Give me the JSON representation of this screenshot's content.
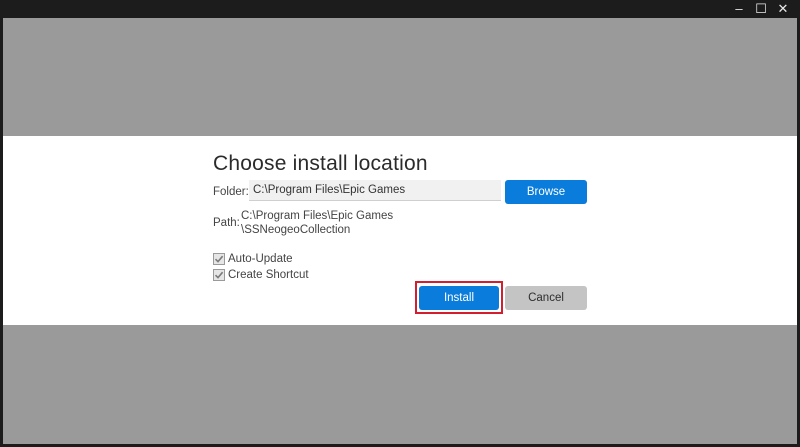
{
  "window": {
    "controls": {
      "minimize": "–",
      "maximize": "☐",
      "close": "✕"
    }
  },
  "dialog": {
    "title": "Choose install location",
    "folder": {
      "label": "Folder:",
      "value": "C:\\Program Files\\Epic Games"
    },
    "browse_label": "Browse",
    "path": {
      "label": "Path:",
      "line1": "C:\\Program Files\\Epic Games",
      "line2": "\\SSNeogeoCollection"
    },
    "options": [
      {
        "label": "Auto-Update",
        "checked": true
      },
      {
        "label": "Create Shortcut",
        "checked": true
      }
    ],
    "install_label": "Install",
    "cancel_label": "Cancel"
  },
  "colors": {
    "primary_button": "#0a7cdb",
    "secondary_button": "#c4c4c4",
    "highlight": "#d11f2f",
    "backdrop": "#9a9a9a",
    "titlebar": "#1c1c1c"
  }
}
